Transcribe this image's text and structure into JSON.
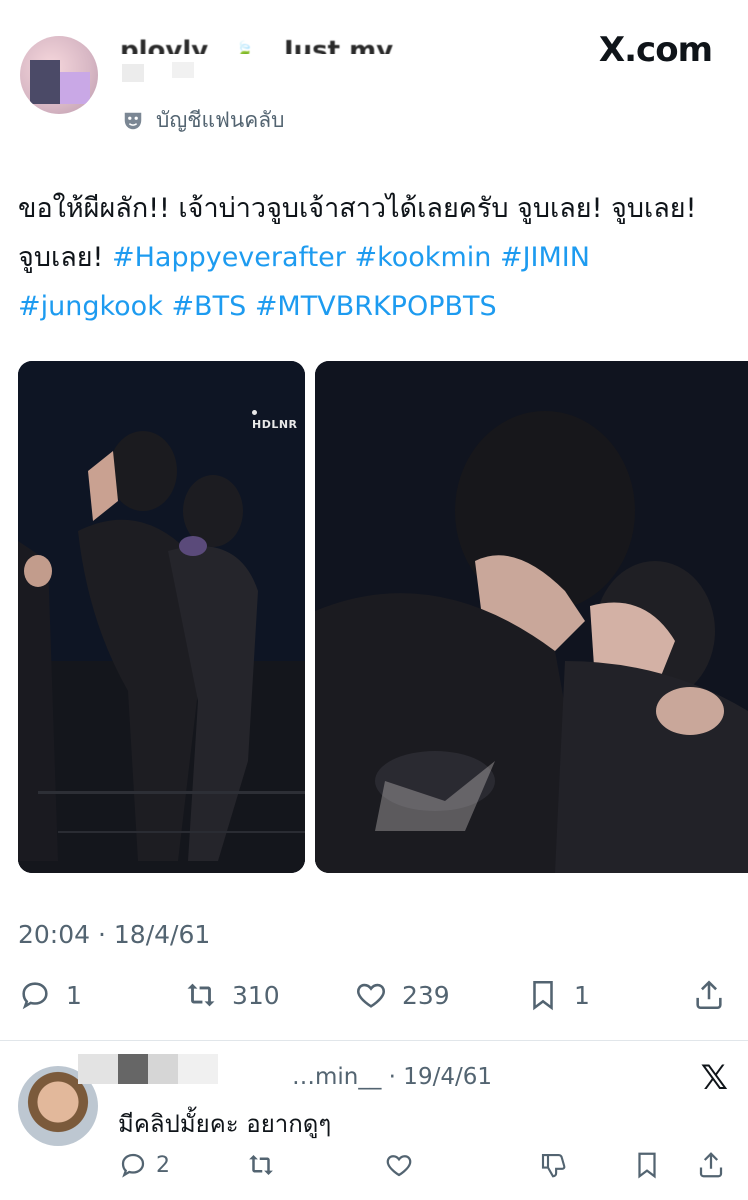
{
  "site": {
    "logo_text": "X.com"
  },
  "author": {
    "name": "plovly",
    "display_extra": "Just my luck",
    "badge": "บัญชีแฟนคลับ",
    "badge_icon": "theater-mask-icon"
  },
  "tweet": {
    "text_parts": [
      {
        "text": "ขอให้ผีผลัก!! เจ้าบ่าวจูบเจ้าสาวได้เลยครับ จูบเลย! จูบเลย! จูบเลย! ",
        "is_tag": false
      },
      {
        "text": "#Happyeverafter",
        "is_tag": true
      },
      {
        "text": " ",
        "is_tag": false
      },
      {
        "text": "#kookmin",
        "is_tag": true
      },
      {
        "text": " ",
        "is_tag": false
      },
      {
        "text": "#JIMIN",
        "is_tag": true
      },
      {
        "text": " ",
        "is_tag": false
      },
      {
        "text": "#jungkook",
        "is_tag": true
      },
      {
        "text": " ",
        "is_tag": false
      },
      {
        "text": "#BTS",
        "is_tag": true
      },
      {
        "text": " ",
        "is_tag": false
      },
      {
        "text": "#MTVBRKPOPBTS",
        "is_tag": true
      }
    ],
    "images": [
      {
        "watermark": "HDLNR"
      },
      {
        "watermark": ""
      }
    ],
    "timestamp": "20:04 · 18/4/61",
    "stats": {
      "replies": "1",
      "retweets": "310",
      "likes": "239",
      "bookmarks": "1"
    }
  },
  "reply": {
    "handle": "…min__ · 19/4/61",
    "text": "มีคลิปมั้ยคะ อยากดูๆ",
    "replies": "2",
    "logo": "𝕏"
  },
  "colors": {
    "link": "#1d9bf0",
    "muted": "#536471",
    "text": "#0f1419"
  }
}
